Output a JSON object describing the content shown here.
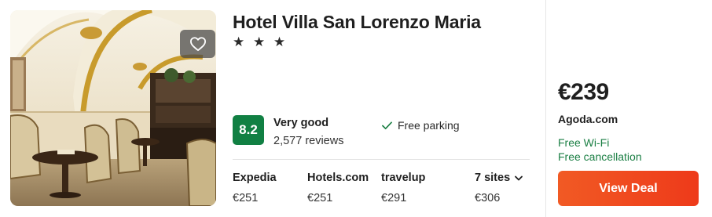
{
  "hotel": {
    "name": "Hotel Villa San Lorenzo Maria",
    "stars": "★ ★ ★",
    "favorite_icon": "heart-outline-icon"
  },
  "rating": {
    "score": "8.2",
    "label": "Very good",
    "reviews": "2,577 reviews",
    "badge_color": "#118043"
  },
  "amenities": {
    "icon": "check-icon",
    "label": "Free parking"
  },
  "sites": [
    {
      "name": "Expedia",
      "price": "€251"
    },
    {
      "name": "Hotels.com",
      "price": "€251"
    },
    {
      "name": "travelup",
      "price": "€291"
    },
    {
      "name": "7 sites",
      "price": "€306",
      "icon": "chevron-down-icon"
    }
  ],
  "deal": {
    "price": "€239",
    "provider": "Agoda.com",
    "perks": [
      "Free Wi-Fi",
      "Free cancellation"
    ],
    "button_label": "View Deal",
    "button_color": "#f15a24",
    "perk_color": "#1b7f44"
  }
}
